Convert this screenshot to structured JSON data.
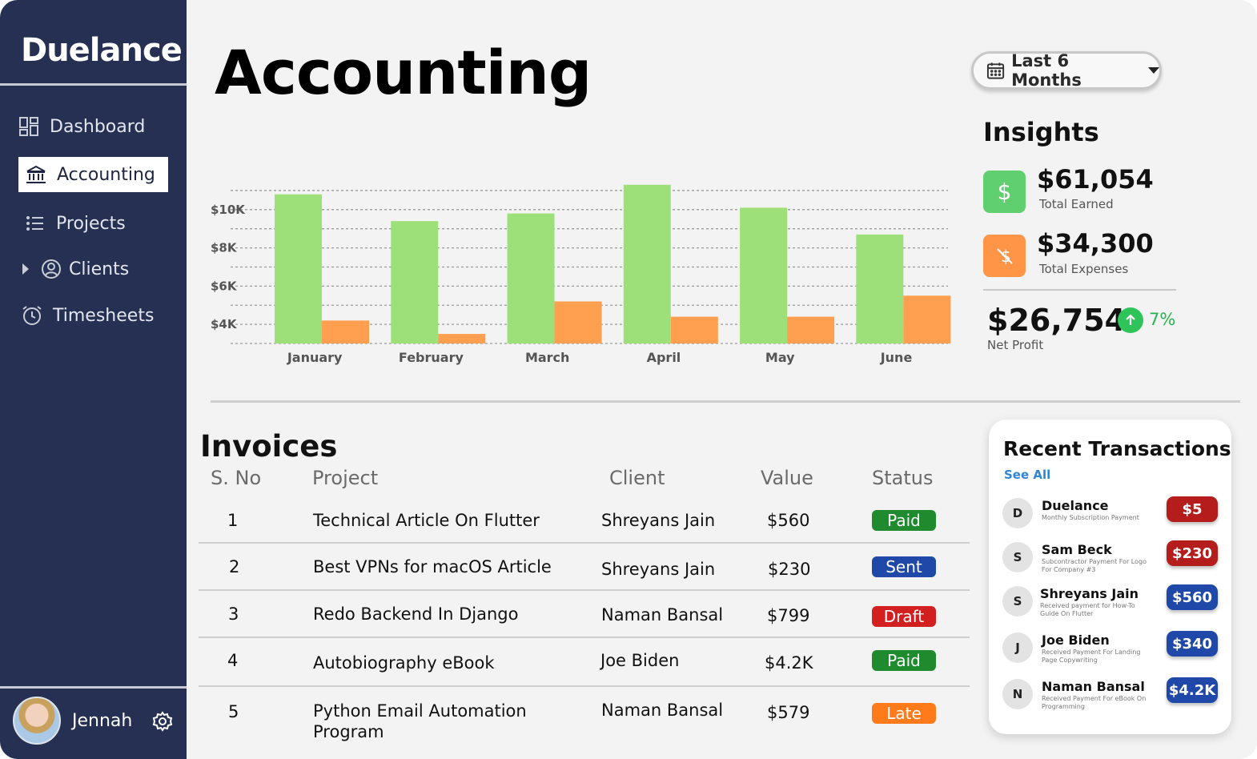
{
  "sidebar": {
    "brand": "Duelance",
    "nav": [
      {
        "label": "Dashboard",
        "icon": "dashboard-icon"
      },
      {
        "label": "Accounting",
        "icon": "bank-icon",
        "active": true
      },
      {
        "label": "Projects",
        "icon": "list-icon"
      },
      {
        "label": "Clients",
        "icon": "user-circle-icon"
      },
      {
        "label": "Timesheets",
        "icon": "alarm-clock-icon"
      }
    ],
    "user": {
      "name": "Jennah"
    }
  },
  "header": {
    "title": "Accounting",
    "date_range": "Last 6 Months"
  },
  "chart_data": {
    "type": "bar",
    "categories": [
      "January",
      "February",
      "March",
      "April",
      "May",
      "June"
    ],
    "series": [
      {
        "color": "#9de07a",
        "values": [
          10.8,
          9.4,
          9.8,
          11.3,
          10.1,
          8.7
        ]
      },
      {
        "color": "#ff9f4f",
        "values": [
          4.2,
          3.5,
          5.2,
          4.4,
          4.4,
          5.5
        ]
      }
    ],
    "y_ticks": [
      "$4K",
      "$6K",
      "$8K",
      "$10K"
    ],
    "ylim": [
      3,
      11.5
    ],
    "grid": true
  },
  "insights": {
    "title": "Insights",
    "earned": {
      "value": "$61,054",
      "label": "Total Earned",
      "color": "#5fcf6f"
    },
    "expenses": {
      "value": "$34,300",
      "label": "Total Expenses",
      "color": "#ff9546"
    },
    "profit": {
      "value": "$26,754",
      "change": "7%",
      "label": "Net Profit"
    }
  },
  "invoices": {
    "title": "Invoices",
    "columns": [
      "S. No",
      "Project",
      "Client",
      "Value",
      "Status"
    ],
    "rows": [
      {
        "no": "1",
        "project": "Technical Article On Flutter",
        "client": "Shreyans Jain",
        "value": "$560",
        "status": "Paid",
        "color": "#1f8a2e"
      },
      {
        "no": "2",
        "project": "Best VPNs for macOS Article",
        "client": "Shreyans Jain",
        "value": "$230",
        "status": "Sent",
        "color": "#1f48a8"
      },
      {
        "no": "3",
        "project": "Redo Backend In Django",
        "client": "Naman Bansal",
        "value": "$799",
        "status": "Draft",
        "color": "#d21f1f"
      },
      {
        "no": "4",
        "project": "Autobiography eBook",
        "client": "Joe Biden",
        "value": "$4.2K",
        "status": "Paid",
        "color": "#1f8a2e"
      },
      {
        "no": "5",
        "project": "Python Email Automation Program",
        "client": "Naman Bansal",
        "value": "$579",
        "status": "Late",
        "color": "#ff7a1a"
      }
    ]
  },
  "transactions": {
    "title": "Recent Transactions",
    "see_all": "See All",
    "items": [
      {
        "initial": "D",
        "name": "Duelance",
        "desc": "Monthly Subscription Payment",
        "amount": "$5",
        "type": "red"
      },
      {
        "initial": "S",
        "name": "Sam Beck",
        "desc": "Subcontractor Payment For Logo For Company #3",
        "amount": "$230",
        "type": "red"
      },
      {
        "initial": "S",
        "name": "Shreyans Jain",
        "desc": "Received payment for How-To Guide On Flutter",
        "amount": "$560",
        "type": "blue"
      },
      {
        "initial": "J",
        "name": "Joe Biden",
        "desc": "Received Payment For Landing Page Copywriting",
        "amount": "$340",
        "type": "blue"
      },
      {
        "initial": "N",
        "name": "Naman Bansal",
        "desc": "Received Payment For eBook On Programming",
        "amount": "$4.2K",
        "type": "blue"
      }
    ]
  }
}
